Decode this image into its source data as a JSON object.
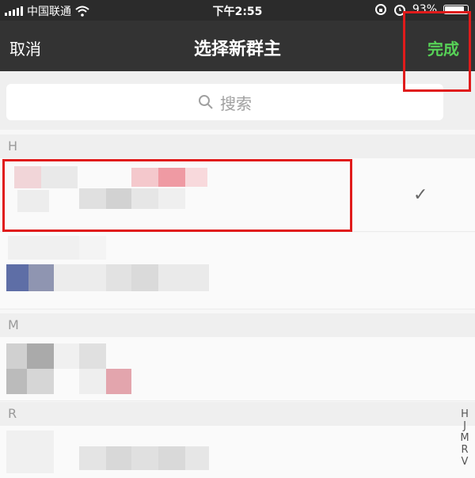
{
  "status_bar": {
    "carrier": "中国联通",
    "time": "下午2:55",
    "battery": "93%"
  },
  "nav": {
    "cancel": "取消",
    "title": "选择新群主",
    "done": "完成"
  },
  "search": {
    "placeholder": "搜索"
  },
  "sections": [
    {
      "letter": "H"
    },
    {
      "letter": "M"
    },
    {
      "letter": "R"
    }
  ],
  "selected_mark": "✓",
  "index_letters": [
    "H",
    "J",
    "M",
    "R",
    "V"
  ],
  "colors": {
    "nav_bg": "#333333",
    "done": "#57d257",
    "annotation": "#e01b1b"
  }
}
